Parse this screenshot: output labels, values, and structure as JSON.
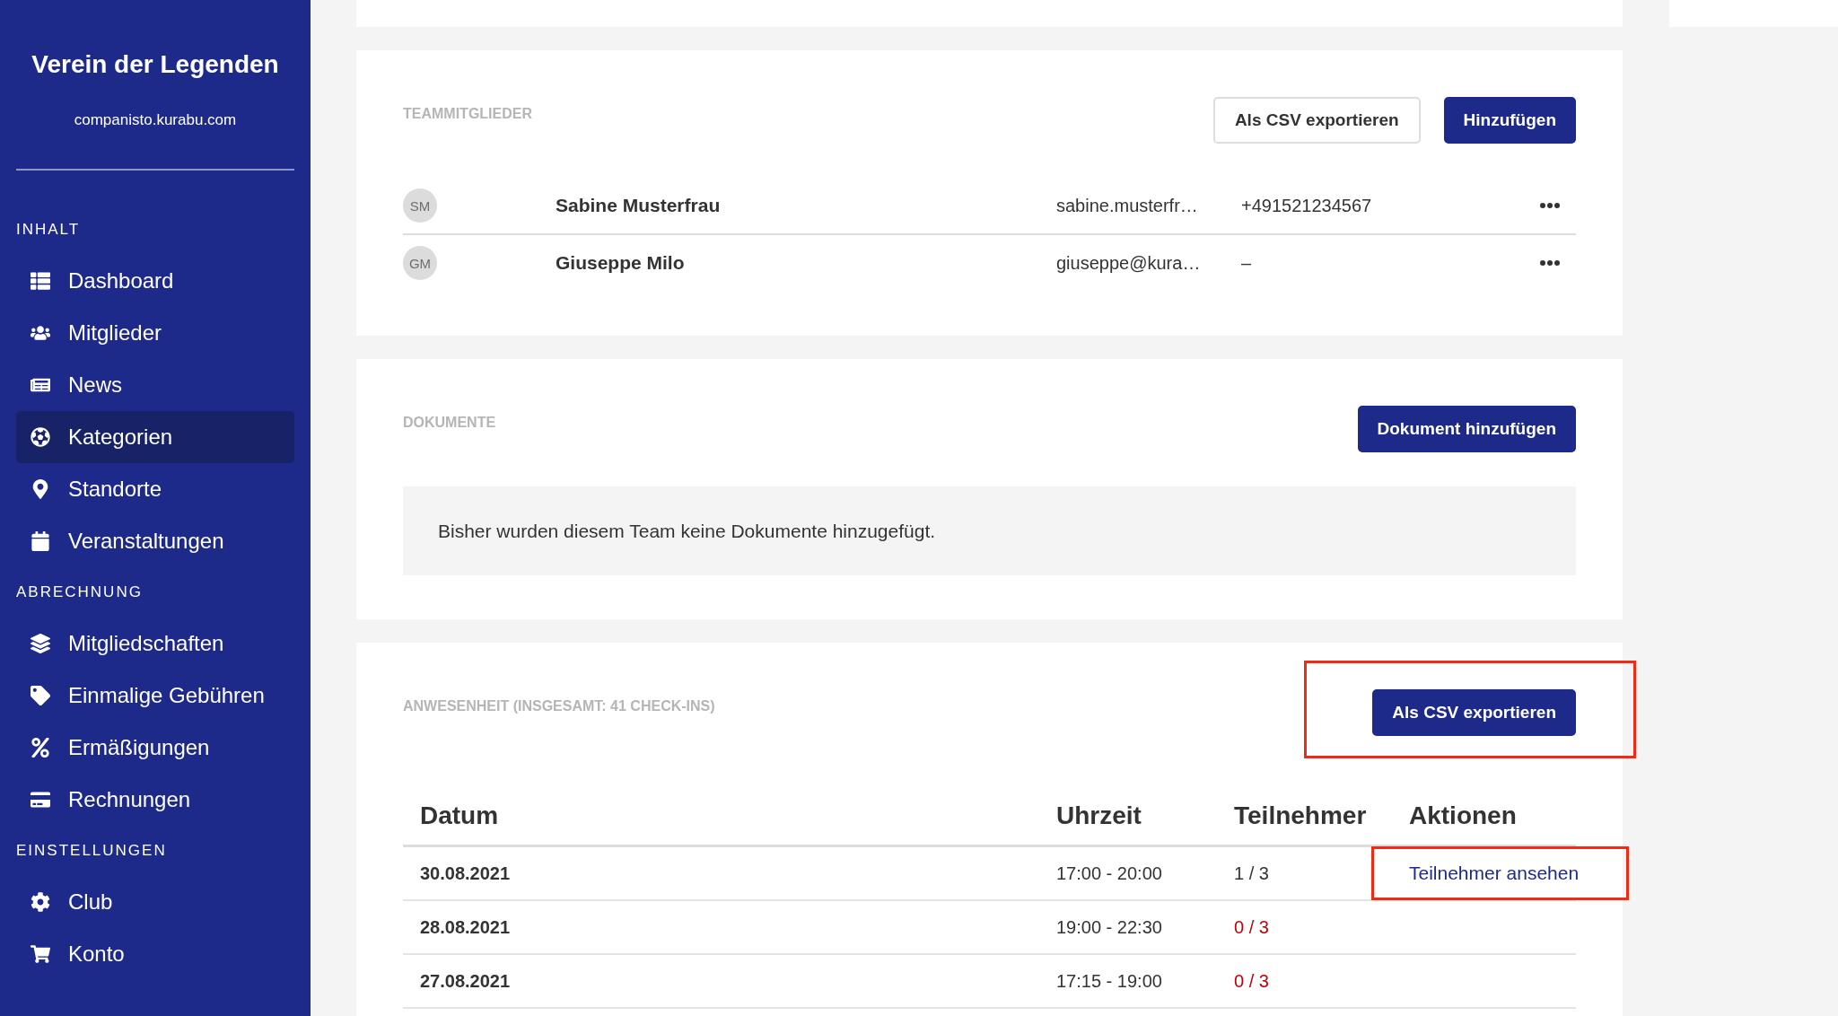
{
  "sidebar": {
    "title": "Verein der Legenden",
    "domain": "companisto.kurabu.com",
    "sections": [
      {
        "heading": "INHALT",
        "items": [
          {
            "label": "Dashboard",
            "selected": false
          },
          {
            "label": "Mitglieder",
            "selected": false
          },
          {
            "label": "News",
            "selected": false
          },
          {
            "label": "Kategorien",
            "selected": true
          },
          {
            "label": "Standorte",
            "selected": false
          },
          {
            "label": "Veranstaltungen",
            "selected": false
          }
        ]
      },
      {
        "heading": "ABRECHNUNG",
        "items": [
          {
            "label": "Mitgliedschaften",
            "selected": false
          },
          {
            "label": "Einmalige Gebühren",
            "selected": false
          },
          {
            "label": "Ermäßigungen",
            "selected": false
          },
          {
            "label": "Rechnungen",
            "selected": false
          }
        ]
      },
      {
        "heading": "EINSTELLUNGEN",
        "items": [
          {
            "label": "Club",
            "selected": false
          },
          {
            "label": "Konto",
            "selected": false
          }
        ]
      }
    ]
  },
  "team_members": {
    "heading": "TEAMMITGLIEDER",
    "buttons": [
      {
        "label": "Als CSV exportieren",
        "kind": "outline"
      },
      {
        "label": "Hinzufügen",
        "kind": "primary"
      }
    ],
    "rows": [
      {
        "initials": "SM",
        "name": "Sabine Musterfrau",
        "email": "sabine.musterfr…",
        "phone": "+491521234567"
      },
      {
        "initials": "GM",
        "name": "Giuseppe Milo",
        "email": "giuseppe@kura…",
        "phone": "–"
      }
    ]
  },
  "documents": {
    "heading": "DOKUMENTE",
    "button": "Dokument hinzufügen",
    "message": "Bisher wurden diesem Team keine Dokumente hinzugefügt."
  },
  "attendance": {
    "heading": "ANWESENHEIT (INSGESAMT: 41 CHECK-INS)",
    "button": {
      "label": "Als CSV exportieren",
      "annotated": true
    },
    "columns": [
      "Datum",
      "Uhrzeit",
      "Teilnehmer",
      "Aktionen"
    ],
    "rows": [
      {
        "date": "30.08.2021",
        "time": "17:00 - 20:00",
        "participants": "1 / 3",
        "color": "#333333",
        "action": {
          "label": "Teilnehmer ansehen",
          "annotated": true
        }
      },
      {
        "date": "28.08.2021",
        "time": "19:00 - 22:30",
        "participants": "0 / 3",
        "color": "#c0000b"
      },
      {
        "date": "27.08.2021",
        "time": "17:15 - 19:00",
        "participants": "0 / 3",
        "color": "#c0000b"
      }
    ]
  }
}
